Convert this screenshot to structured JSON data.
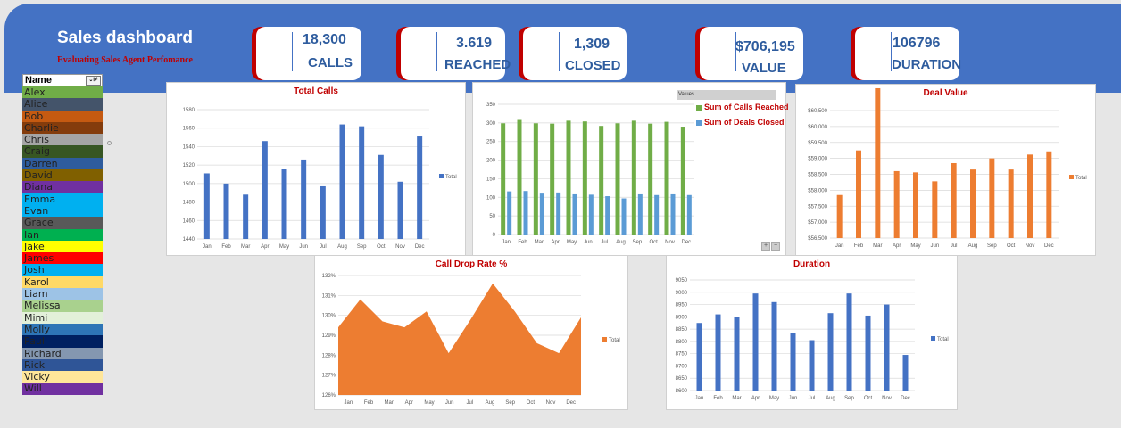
{
  "header": {
    "title": "Sales dashboard",
    "subtitle": "Evaluating Sales Agent Perfomance"
  },
  "kpis": {
    "calls": {
      "value": "18,300",
      "label": "CALLS"
    },
    "reached": {
      "value": "3.619",
      "label": "REACHED"
    },
    "closed": {
      "value": "1,309",
      "label": "CLOSED"
    },
    "value": {
      "value": "$706,195",
      "label": "VALUE"
    },
    "duration": {
      "value": "106796",
      "label": "DURATION"
    }
  },
  "filter": {
    "header": "Name",
    "button": "⌄⊮",
    "items": [
      {
        "name": "Alex",
        "color": "#70ad47"
      },
      {
        "name": "Alice",
        "color": "#44546a"
      },
      {
        "name": "Bob",
        "color": "#c55a11"
      },
      {
        "name": "Charlie",
        "color": "#843c0c"
      },
      {
        "name": "Chris",
        "color": "#a5a5a5"
      },
      {
        "name": "Craig",
        "color": "#375623"
      },
      {
        "name": "Darren",
        "color": "#2e5c9e"
      },
      {
        "name": "David",
        "color": "#806000"
      },
      {
        "name": "Diana",
        "color": "#7030a0"
      },
      {
        "name": "Emma",
        "color": "#00b0f0"
      },
      {
        "name": "Evan",
        "color": "#00b0f0"
      },
      {
        "name": "Grace",
        "color": "#595959"
      },
      {
        "name": "Ian",
        "color": "#00b050"
      },
      {
        "name": "Jake",
        "color": "#ffff00"
      },
      {
        "name": "James",
        "color": "#ff0000"
      },
      {
        "name": "Josh",
        "color": "#00b0f0"
      },
      {
        "name": "Karol",
        "color": "#ffd966"
      },
      {
        "name": "Liam",
        "color": "#9dc3e6"
      },
      {
        "name": "Melissa",
        "color": "#a9d18e"
      },
      {
        "name": "Mimi",
        "color": "#e2f0d9"
      },
      {
        "name": "Molly",
        "color": "#2e75b6"
      },
      {
        "name": "Paul",
        "color": "#002060"
      },
      {
        "name": "Richard",
        "color": "#8497b0"
      },
      {
        "name": "Rick",
        "color": "#2f5597"
      },
      {
        "name": "Vicky",
        "color": "#ffe699"
      },
      {
        "name": "Will",
        "color": "#7030a0"
      }
    ]
  },
  "colors": {
    "blue": "#4472c4",
    "orange": "#ed7d31",
    "green": "#70ad47",
    "lightblue": "#5b9bd5",
    "title_red": "#c00000"
  },
  "chart_data": [
    {
      "id": "total_calls",
      "type": "bar",
      "title": "Total Calls",
      "categories": [
        "Jan",
        "Feb",
        "Mar",
        "Apr",
        "May",
        "Jun",
        "Jul",
        "Aug",
        "Sep",
        "Oct",
        "Nov",
        "Dec"
      ],
      "series": [
        {
          "name": "Total",
          "values": [
            1511,
            1500,
            1488,
            1546,
            1516,
            1526,
            1497,
            1564,
            1562,
            1531,
            1502,
            1551
          ]
        }
      ],
      "ylim": [
        1440,
        1580
      ],
      "yticks": [
        "1440",
        "1460",
        "1480",
        "1500",
        "1520",
        "1540",
        "1560",
        "1580"
      ],
      "grid": true,
      "legend": "right"
    },
    {
      "id": "reached_closed",
      "type": "bar",
      "title": "",
      "legend_header": "Values",
      "categories": [
        "Jan",
        "Feb",
        "Mar",
        "Apr",
        "May",
        "Jun",
        "Jul",
        "Aug",
        "Sep",
        "Oct",
        "Nov",
        "Dec"
      ],
      "series": [
        {
          "name": "Sum of Calls Reached",
          "values": [
            299,
            308,
            299,
            298,
            306,
            304,
            292,
            299,
            306,
            298,
            303,
            290
          ]
        },
        {
          "name": "Sum of Deals Closed",
          "values": [
            116,
            117,
            110,
            113,
            108,
            107,
            103,
            97,
            108,
            106,
            108,
            106
          ]
        }
      ],
      "ylim": [
        0,
        350
      ],
      "yticks": [
        "0",
        "50",
        "100",
        "150",
        "200",
        "250",
        "300",
        "350"
      ],
      "grid": true,
      "legend": "top-right"
    },
    {
      "id": "deal_value",
      "type": "bar",
      "title": "Deal Value",
      "categories": [
        "Jan",
        "Feb",
        "Mar",
        "Apr",
        "May",
        "Jun",
        "Jul",
        "Aug",
        "Sep",
        "Oct",
        "Nov",
        "Dec"
      ],
      "series": [
        {
          "name": "Total",
          "values": [
            57850,
            59250,
            61200,
            58600,
            58560,
            58280,
            58850,
            58650,
            59000,
            58650,
            59120,
            59220
          ]
        }
      ],
      "ylim": [
        56500,
        60500
      ],
      "yticks": [
        "$56,500",
        "$57,000",
        "$57,500",
        "$58,000",
        "$58,500",
        "$59,000",
        "$59,500",
        "$60,000",
        "$60,500"
      ],
      "grid": true,
      "legend": "right"
    },
    {
      "id": "call_drop_rate",
      "type": "area",
      "title": "Call Drop Rate %",
      "categories": [
        "Jan",
        "Feb",
        "Mar",
        "Apr",
        "May",
        "Jun",
        "Jul",
        "Aug",
        "Sep",
        "Oct",
        "Nov",
        "Dec"
      ],
      "series": [
        {
          "name": "Total",
          "values": [
            12.94,
            13.08,
            12.97,
            12.94,
            13.02,
            12.81,
            12.98,
            13.16,
            13.02,
            12.86,
            12.81,
            12.99
          ]
        }
      ],
      "ylim": [
        12.6,
        13.2
      ],
      "yticks": [
        "126%",
        "127%",
        "128%",
        "129%",
        "130%",
        "131%",
        "132%"
      ],
      "grid": true,
      "legend": "right"
    },
    {
      "id": "duration",
      "type": "bar",
      "title": "Duration",
      "categories": [
        "Jan",
        "Feb",
        "Mar",
        "Apr",
        "May",
        "Jun",
        "Jul",
        "Aug",
        "Sep",
        "Oct",
        "Nov",
        "Dec"
      ],
      "series": [
        {
          "name": "Total",
          "values": [
            8875,
            8910,
            8900,
            8995,
            8960,
            8835,
            8805,
            8915,
            8995,
            8905,
            8950,
            8745
          ]
        }
      ],
      "ylim": [
        8600,
        9050
      ],
      "yticks": [
        "8600",
        "8650",
        "8700",
        "8750",
        "8800",
        "8850",
        "8900",
        "8950",
        "9000",
        "9050"
      ],
      "grid": true,
      "legend": "right"
    }
  ]
}
